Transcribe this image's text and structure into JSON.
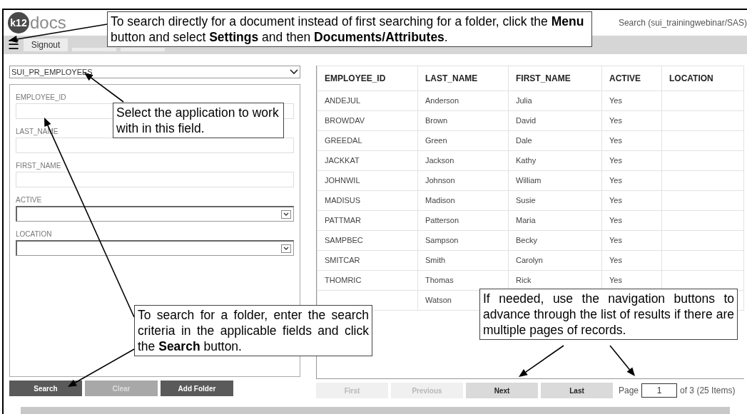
{
  "header": {
    "logo_badge": "k12",
    "logo_text": "docs",
    "search_label": "Search (sui_trainingwebinar/SAS)"
  },
  "toolbar": {
    "menu_icon": "☰",
    "buttons": [
      {
        "kind": "labeled",
        "label": "Signout"
      },
      {
        "kind": "covered"
      },
      {
        "kind": "covered"
      }
    ]
  },
  "application_select": {
    "value": "SUI_PR_EMPLOYEES"
  },
  "search_form": {
    "fields": [
      {
        "label": "EMPLOYEE_ID",
        "kind": "text"
      },
      {
        "label": "LAST_NAME",
        "kind": "text"
      },
      {
        "label": "FIRST_NAME",
        "kind": "text"
      },
      {
        "label": "ACTIVE",
        "kind": "select"
      },
      {
        "label": "LOCATION",
        "kind": "select"
      }
    ],
    "buttons": [
      {
        "label": "Search",
        "disabled": false
      },
      {
        "label": "Clear",
        "disabled": true
      },
      {
        "label": "Add Folder",
        "disabled": false
      }
    ]
  },
  "table": {
    "columns": [
      "EMPLOYEE_ID",
      "LAST_NAME",
      "FIRST_NAME",
      "ACTIVE",
      "LOCATION"
    ],
    "rows": [
      [
        "ANDEJUL",
        "Anderson",
        "Julia",
        "Yes",
        ""
      ],
      [
        "BROWDAV",
        "Brown",
        "David",
        "Yes",
        ""
      ],
      [
        "GREEDAL",
        "Green",
        "Dale",
        "Yes",
        ""
      ],
      [
        "JACKKAT",
        "Jackson",
        "Kathy",
        "Yes",
        ""
      ],
      [
        "JOHNWIL",
        "Johnson",
        "William",
        "Yes",
        ""
      ],
      [
        "MADISUS",
        "Madison",
        "Susie",
        "Yes",
        ""
      ],
      [
        "PATTMAR",
        "Patterson",
        "Maria",
        "Yes",
        ""
      ],
      [
        "SAMPBEC",
        "Sampson",
        "Becky",
        "Yes",
        ""
      ],
      [
        "SMITCAR",
        "Smith",
        "Carolyn",
        "Yes",
        ""
      ],
      [
        "THOMRIC",
        "Thomas",
        "Rick",
        "Yes",
        ""
      ],
      [
        "",
        "Watson",
        "",
        "",
        ""
      ]
    ]
  },
  "pagination": {
    "buttons": [
      {
        "label": "First",
        "disabled": true
      },
      {
        "label": "Previous",
        "disabled": true
      },
      {
        "label": "Next",
        "disabled": false
      },
      {
        "label": "Last",
        "disabled": false
      }
    ],
    "page_label": "Page",
    "page_value": "1",
    "page_total": "of 3 (25 Items)"
  },
  "callouts": [
    {
      "text": "To search directly for a document instead of first searching for a folder, click the **Menu** button and select **Settings** and then **Documents/Attributes**."
    },
    {
      "text": "Select the application to work with in this field."
    },
    {
      "text": "To search for a folder, enter the search criteria in the applicable fields and click the **Search** button."
    },
    {
      "text": "If needed, use the navigation buttons to advance through the list of results if there are multiple pages of records."
    }
  ]
}
